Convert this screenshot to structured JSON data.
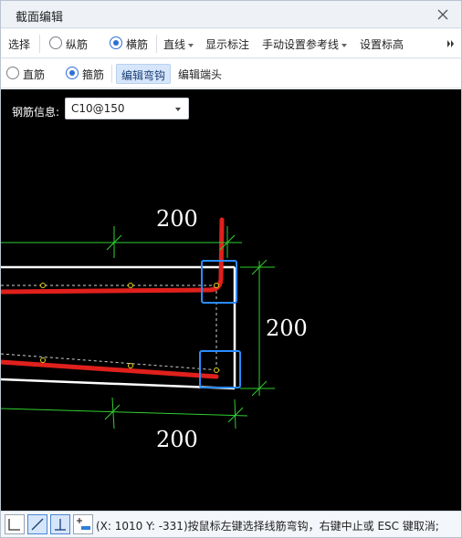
{
  "window": {
    "title": "截面编辑"
  },
  "toolbar1": {
    "select_label": "选择",
    "longitudinal_label": "纵筋",
    "horizontal_label": "横筋",
    "line_dropdown": "直线",
    "show_dim_label": "显示标注",
    "manual_ref_label": "手动设置参考线",
    "set_elevation_label": "设置标高"
  },
  "toolbar2": {
    "straight_label": "直筋",
    "stirrup_label": "箍筋",
    "edit_hook_label": "编辑弯钩",
    "edit_end_label": "编辑端头"
  },
  "canvas": {
    "rebar_info_label": "钢筋信息:",
    "rebar_info_value": "C10@150",
    "dim_top": "200",
    "dim_right": "200",
    "dim_bottom": "200"
  },
  "statusbar": {
    "coords_text": "(X: 1010 Y: -331)",
    "prompt": "按鼠标左键选择线筋弯钩，右键中止或 ESC 键取消;"
  },
  "colors": {
    "canvas_bg": "#000000",
    "rebar_red": "#e0201c",
    "outline_white": "#ffffff",
    "dim_green": "#2fd02f",
    "highlight_blue": "#2a8cff",
    "accent": "#2f6fd6"
  }
}
